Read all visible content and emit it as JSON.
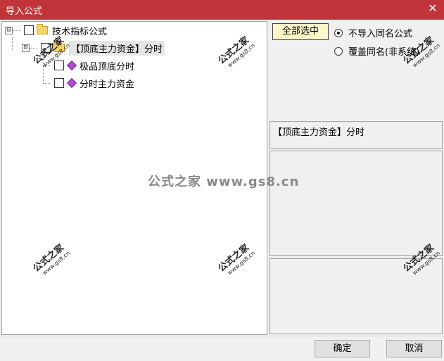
{
  "window": {
    "title": "导入公式",
    "close_symbol": "✕"
  },
  "tree": {
    "root": {
      "label": "技术指标公式",
      "expander": "⊟"
    },
    "group": {
      "label": "【顶底主力资金】分时",
      "expander": "⊟"
    },
    "items": [
      {
        "label": "极品顶底分时"
      },
      {
        "label": "分时主力资金"
      }
    ]
  },
  "options": {
    "select_all_label": "全部选中",
    "radio_no_import": "不导入同名公式",
    "radio_overwrite": "覆盖同名(非系统)",
    "selected": "no_import"
  },
  "detail": {
    "formula_name": "【顶底主力资金】分时"
  },
  "buttons": {
    "ok": "确定",
    "cancel": "取消"
  },
  "watermark": {
    "main": "公式之家 www.gs8.cn",
    "small_cn": "公式之家",
    "small_url": "www.gs8.cn"
  }
}
